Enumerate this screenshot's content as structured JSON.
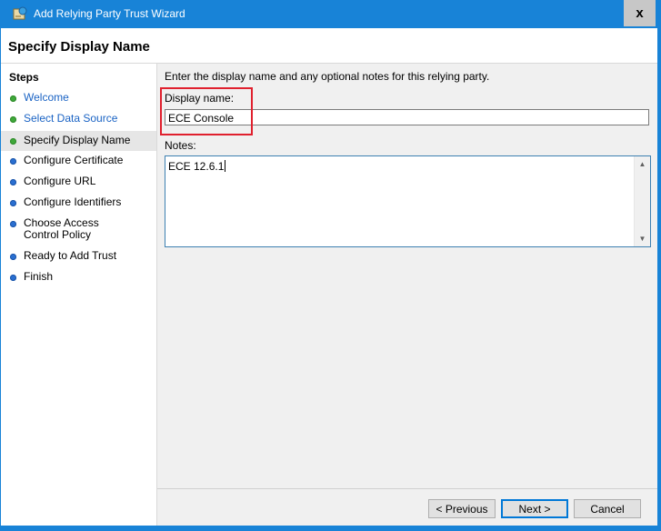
{
  "window": {
    "title": "Add Relying Party Trust Wizard",
    "close_label": "x",
    "accent_color": "#1883d7"
  },
  "header": {
    "page_title": "Specify Display Name"
  },
  "steps": {
    "heading": "Steps",
    "items": [
      {
        "label": "Welcome",
        "status": "complete"
      },
      {
        "label": "Select Data Source",
        "status": "complete"
      },
      {
        "label": "Specify Display Name",
        "status": "current"
      },
      {
        "label": "Configure Certificate",
        "status": "pending"
      },
      {
        "label": "Configure URL",
        "status": "pending"
      },
      {
        "label": "Configure Identifiers",
        "status": "pending"
      },
      {
        "label": "Choose Access Control Policy",
        "status": "pending"
      },
      {
        "label": "Ready to Add Trust",
        "status": "pending"
      },
      {
        "label": "Finish",
        "status": "pending"
      }
    ]
  },
  "form": {
    "instructions": "Enter the display name and any optional notes for this relying party.",
    "display_name_label": "Display name:",
    "display_name_value": "ECE Console",
    "notes_label": "Notes:",
    "notes_value": "ECE 12.6.1"
  },
  "buttons": {
    "previous": "< Previous",
    "next": "Next >",
    "cancel": "Cancel"
  }
}
